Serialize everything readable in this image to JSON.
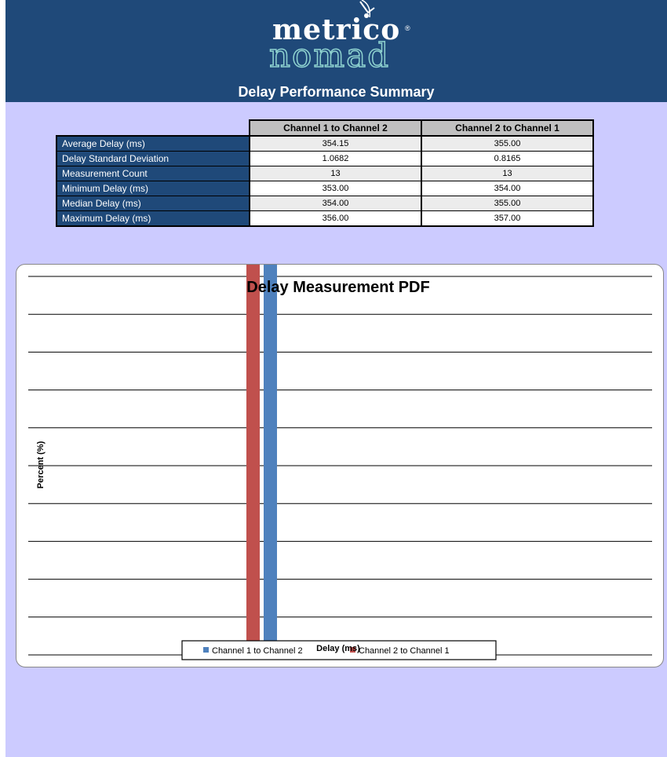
{
  "header": {
    "logo_top": "metrico",
    "logo_bottom": "nomad",
    "logo_reg": "®",
    "title": "Delay Performance Summary"
  },
  "stats": {
    "columns": [
      "Channel 1 to Channel 2",
      "Channel 2 to Channel 1"
    ],
    "rows": [
      {
        "label": "Average Delay (ms)",
        "values": [
          "354.15",
          "355.00"
        ]
      },
      {
        "label": "Delay Standard Deviation",
        "values": [
          "1.0682",
          "0.8165"
        ]
      },
      {
        "label": "Measurement Count",
        "values": [
          "13",
          "13"
        ]
      },
      {
        "label": "Minimum Delay (ms)",
        "values": [
          "353.00",
          "354.00"
        ]
      },
      {
        "label": "Median Delay (ms)",
        "values": [
          "354.00",
          "355.00"
        ]
      },
      {
        "label": "Maximum Delay (ms)",
        "values": [
          "356.00",
          "357.00"
        ]
      }
    ]
  },
  "chart_data": {
    "type": "bar",
    "title": "Delay Measurement  PDF",
    "xlabel": "Delay (ms)",
    "ylabel": "Percent (%)",
    "grid": true,
    "legend_position": "bottom",
    "series": [
      {
        "name": "Channel 1 to Channel 2",
        "color": "#4f81bd"
      },
      {
        "name": "Channel 2 to Channel 1",
        "color": "#c0504d"
      }
    ]
  },
  "colors": {
    "banner": "#1f4979",
    "page_background": "#cccbff",
    "series_1": "#4f81bd",
    "series_2": "#c0504d"
  }
}
